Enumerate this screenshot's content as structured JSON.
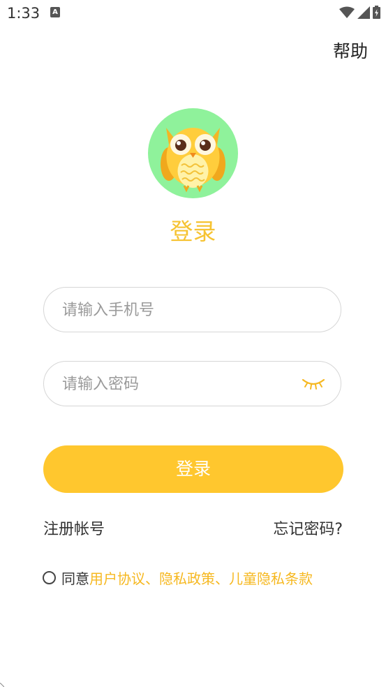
{
  "status_bar": {
    "time": "1:33",
    "app_icon_glyph": "A",
    "icons": [
      "wifi-icon",
      "signal-icon",
      "battery-icon"
    ]
  },
  "header": {
    "help_label": "帮助"
  },
  "avatar": {
    "icon": "owl-mascot-icon",
    "background": "#8ff29b"
  },
  "title": "登录",
  "form": {
    "phone_placeholder": "请输入手机号",
    "phone_value": "",
    "password_placeholder": "请输入密码",
    "password_value": "",
    "password_toggle_icon": "eye-closed-icon",
    "login_label": "登录"
  },
  "links": {
    "register": "注册帐号",
    "forgot_password": "忘记密码?"
  },
  "agreement": {
    "prefix": "同意",
    "user_agreement": "用户协议",
    "sep1": "、",
    "privacy_policy": "隐私政策",
    "sep2": "、",
    "children_privacy": "儿童隐私条款"
  },
  "colors": {
    "accent": "#ffc72e",
    "link": "#f6b820",
    "title": "#f6c332",
    "avatar_bg": "#8ff29b"
  }
}
